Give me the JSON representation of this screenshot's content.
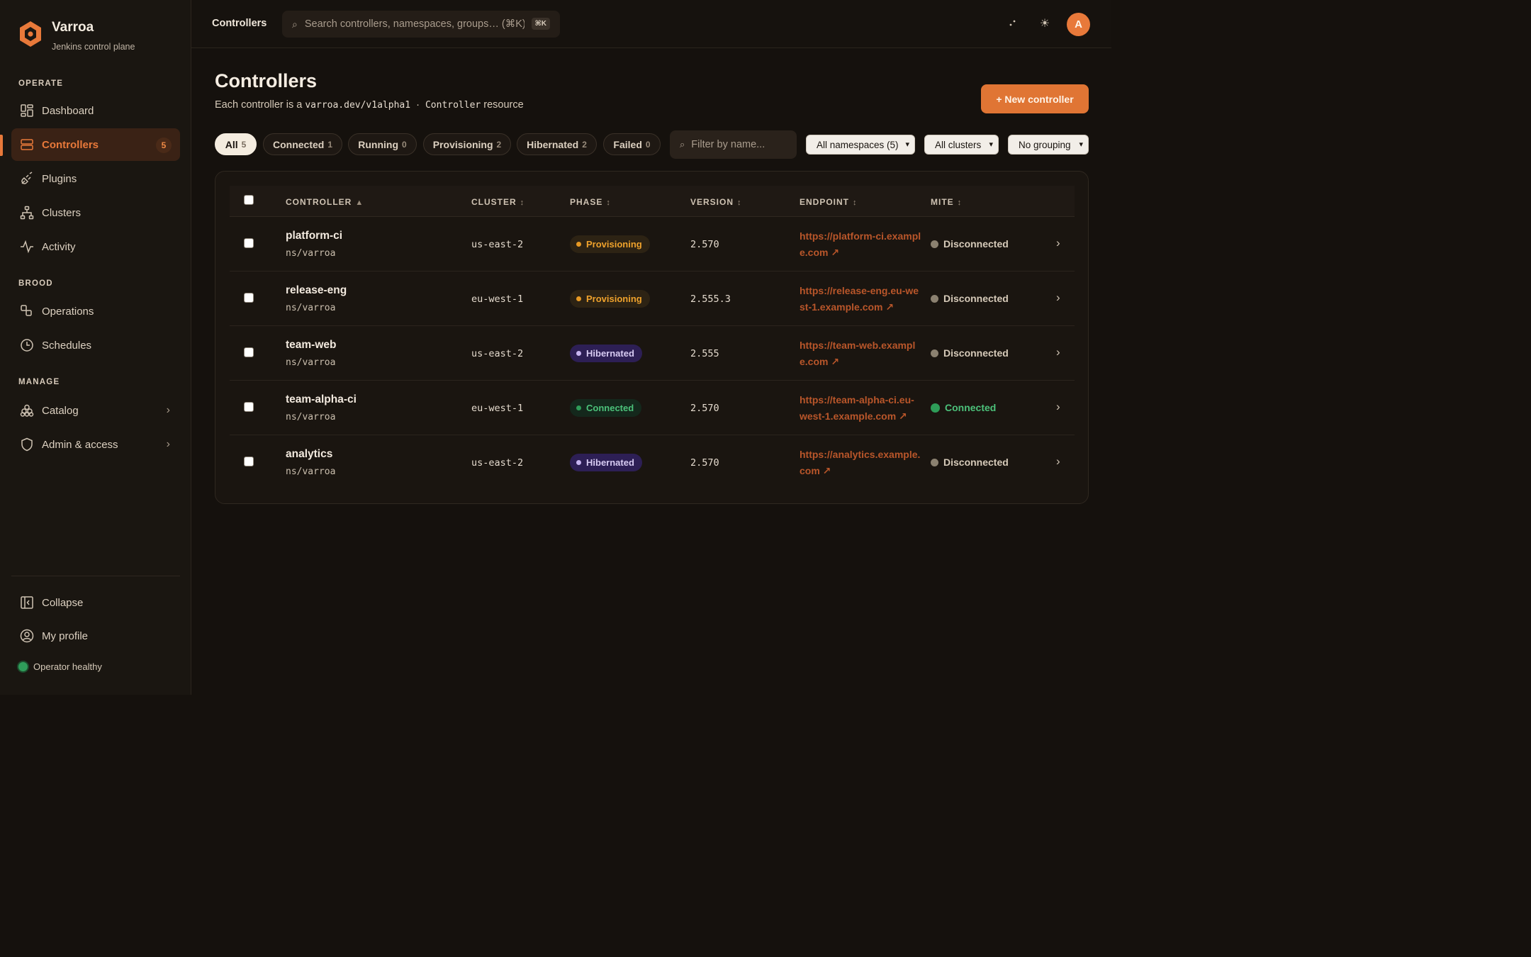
{
  "brand": {
    "name": "Varroa",
    "subtitle": "Jenkins control plane"
  },
  "sidebar": {
    "sections": {
      "operate": "OPERATE",
      "brood": "BROOD",
      "manage": "MANAGE"
    },
    "items": [
      {
        "label": "Dashboard",
        "icon": "dashboard-icon"
      },
      {
        "label": "Controllers",
        "icon": "server-icon",
        "badge": "5",
        "active": true
      },
      {
        "label": "Plugins",
        "icon": "plug-icon"
      },
      {
        "label": "Clusters",
        "icon": "network-icon"
      },
      {
        "label": "Activity",
        "icon": "activity-icon"
      },
      {
        "label": "Operations",
        "icon": "operations-icon"
      },
      {
        "label": "Schedules",
        "icon": "clock-icon"
      },
      {
        "label": "Catalog",
        "icon": "catalog-icon"
      },
      {
        "label": "Admin & access",
        "icon": "shield-icon"
      }
    ],
    "footer": {
      "collapse": "Collapse",
      "profile": "My profile",
      "health": "Operator healthy"
    }
  },
  "topbar": {
    "title": "Controllers",
    "search_placeholder": "Search controllers, namespaces, groups… (⌘K)",
    "shortcut": "⌘K",
    "avatar_initial": "A"
  },
  "page": {
    "title": "Controllers",
    "subtitle_prefix": "Each controller is a",
    "subtitle_api": "varroa.dev/v1alpha1",
    "subtitle_sep": "·",
    "subtitle_kind": "Controller",
    "subtitle_suffix": "resource",
    "new_button": "+ New controller"
  },
  "filters": {
    "pills": [
      {
        "label": "All",
        "count": "5",
        "active": true
      },
      {
        "label": "Connected",
        "count": "1"
      },
      {
        "label": "Running",
        "count": "0"
      },
      {
        "label": "Provisioning",
        "count": "2"
      },
      {
        "label": "Hibernated",
        "count": "2"
      },
      {
        "label": "Failed",
        "count": "0"
      }
    ],
    "name_placeholder": "Filter by name...",
    "namespaces": "All namespaces (5)",
    "clusters": "All clusters",
    "grouping": "No grouping"
  },
  "table": {
    "columns": {
      "controller": "CONTROLLER",
      "controller_sort": "▲",
      "cluster": "CLUSTER",
      "phase": "PHASE",
      "version": "VERSION",
      "endpoint": "ENDPOINT",
      "mite": "MITE",
      "sort": "↕"
    },
    "rows": [
      {
        "name": "platform-ci",
        "namespace": "ns/varroa",
        "cluster": "us-east-2",
        "phase": "Provisioning",
        "version": "2.570",
        "endpoint": "https://platform-ci.example.com ↗",
        "mite": "Disconnected"
      },
      {
        "name": "release-eng",
        "namespace": "ns/varroa",
        "cluster": "eu-west-1",
        "phase": "Provisioning",
        "version": "2.555.3",
        "endpoint": "https://release-eng.eu-west-1.example.com ↗",
        "mite": "Disconnected"
      },
      {
        "name": "team-web",
        "namespace": "ns/varroa",
        "cluster": "us-east-2",
        "phase": "Hibernated",
        "version": "2.555",
        "endpoint": "https://team-web.example.com ↗",
        "mite": "Disconnected"
      },
      {
        "name": "team-alpha-ci",
        "namespace": "ns/varroa",
        "cluster": "eu-west-1",
        "phase": "Connected",
        "version": "2.570",
        "endpoint": "https://team-alpha-ci.eu-west-1.example.com ↗",
        "mite": "Connected"
      },
      {
        "name": "analytics",
        "namespace": "ns/varroa",
        "cluster": "us-east-2",
        "phase": "Hibernated",
        "version": "2.570",
        "endpoint": "https://analytics.example.com ↗",
        "mite": "Disconnected"
      }
    ]
  },
  "colors": {
    "accent": "#e8793a",
    "background": "#15110d",
    "provisioning": "#efa22c",
    "hibernated": "#c7b5f1",
    "connected": "#4cc17a",
    "link": "#b9562a"
  }
}
